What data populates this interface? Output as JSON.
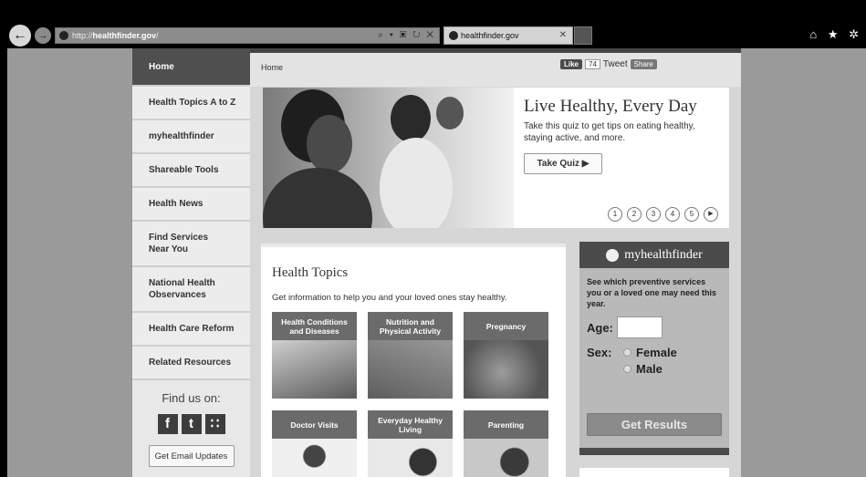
{
  "browser": {
    "url_prefix": "http://",
    "url_domain": "healthfinder.gov",
    "url_suffix": "/",
    "address_tools": "⌕ ▾ ▣ ↻ ✕",
    "tab_title": "healthfinder.gov",
    "tab_close": "✕",
    "icons": [
      "home-icon",
      "favorites-star-icon",
      "settings-gear-icon"
    ],
    "icon_glyphs": "⌂ ★ ✲"
  },
  "sidebar": {
    "items": [
      {
        "label": "Home",
        "active": true
      },
      {
        "label": "Health Topics A to Z"
      },
      {
        "label": "myhealthfinder"
      },
      {
        "label": "Shareable Tools"
      },
      {
        "label": "Health News"
      },
      {
        "label": "Find Services\nNear You"
      },
      {
        "label": "National Health\nObservances"
      },
      {
        "label": "Health Care Reform"
      },
      {
        "label": "Related Resources"
      }
    ],
    "find_us": "Find us on:",
    "social": [
      {
        "icon": "facebook-icon",
        "glyph": "f"
      },
      {
        "icon": "twitter-icon",
        "glyph": "t"
      },
      {
        "icon": "rss-icon",
        "glyph": "∷"
      }
    ],
    "email_button": "Get Email Updates"
  },
  "breadcrumb": "Home",
  "social_share": {
    "like_label": "Like",
    "like_count": "74",
    "tweet_label": "Tweet",
    "share_label": "Share"
  },
  "hero": {
    "title": "Live Healthy, Every Day",
    "text": "Take this quiz to get tips on eating healthy, staying active, and more.",
    "button": "Take Quiz ▶",
    "pages": [
      "1",
      "2",
      "3",
      "4",
      "5"
    ],
    "play": "▶"
  },
  "health_topics": {
    "title": "Health Topics",
    "description": "Get information to help you and your loved ones stay healthy.",
    "tiles": [
      "Health Conditions and Diseases",
      "Nutrition and Physical Activity",
      "Pregnancy",
      "Doctor Visits",
      "Everyday Healthy Living",
      "Parenting"
    ]
  },
  "widget": {
    "title": "myhealthfinder",
    "description": "See which preventive services you or a loved one may need this year.",
    "age_label": "Age:",
    "sex_label": "Sex:",
    "options": [
      "Female",
      "Male"
    ],
    "button": "Get Results"
  }
}
